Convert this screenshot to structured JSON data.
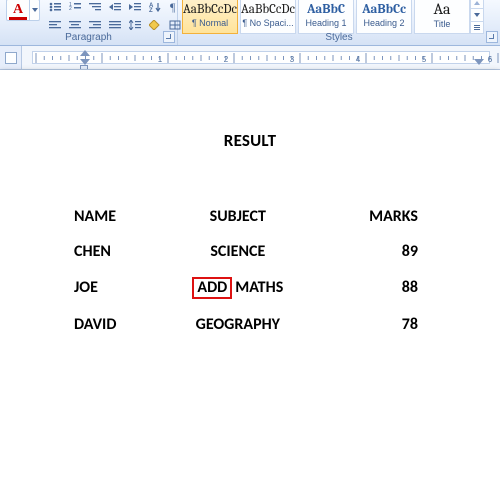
{
  "ribbon": {
    "paragraph": {
      "label": "Paragraph"
    },
    "styles": {
      "label": "Styles",
      "items": [
        {
          "preview": "AaBbCcDc",
          "name": "¶ Normal",
          "cls": "selected"
        },
        {
          "preview": "AaBbCcDc",
          "name": "¶ No Spaci...",
          "cls": ""
        },
        {
          "preview": "AaBbC",
          "name": "Heading 1",
          "cls": "h1"
        },
        {
          "preview": "AaBbCc",
          "name": "Heading 2",
          "cls": "h2"
        },
        {
          "preview": "Aa",
          "name": "Title",
          "cls": "title"
        }
      ]
    }
  },
  "document": {
    "title": "RESULT",
    "headers": {
      "name": "NAME",
      "subject": "SUBJECT",
      "marks": "MARKS"
    },
    "rows": [
      {
        "name": "CHEN",
        "subject": "SCIENCE",
        "marks": "89",
        "prefix": ""
      },
      {
        "name": "JOE",
        "subject": "MATHS",
        "marks": "88",
        "prefix": "ADD"
      },
      {
        "name": "DAVID",
        "subject": "GEOGRAPHY",
        "marks": "78",
        "prefix": ""
      }
    ]
  }
}
